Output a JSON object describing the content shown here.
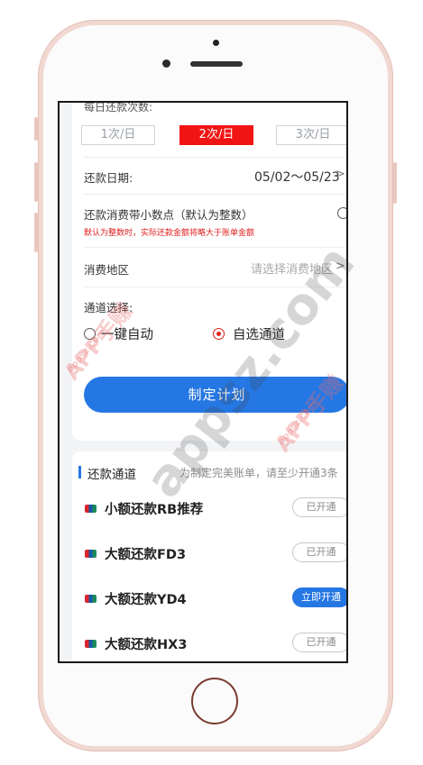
{
  "daily": {
    "label": "每日还款次数:",
    "options": [
      "1次/日",
      "2次/日",
      "3次/日"
    ],
    "selected_index": 1
  },
  "repay_date": {
    "label": "还款日期:",
    "value": "05/02～05/23"
  },
  "decimal": {
    "label": "还款消费带小数点（默认为整数）",
    "warning": "默认为整数时，实际还款金额将略大于账单金额"
  },
  "region": {
    "label": "消费地区",
    "placeholder": "请选择消费地区"
  },
  "channel_select": {
    "label": "通道选择:",
    "options": [
      "一键自动",
      "自选通道"
    ],
    "selected_index": 1
  },
  "plan_button": "制定计划",
  "channels": {
    "title": "还款通道",
    "hint": "为制定完美账单，请至少开通3条",
    "items": [
      {
        "name": "小额还款RB推荐",
        "action": "已开通",
        "style": "outline"
      },
      {
        "name": "大额还款FD3",
        "action": "已开通",
        "style": "outline"
      },
      {
        "name": "大额还款YD4",
        "action": "立即开通",
        "style": "primary"
      },
      {
        "name": "大额还款HX3",
        "action": "已开通",
        "style": "outline"
      }
    ]
  },
  "watermark": {
    "line1": "APP手赚",
    "line2": "appsz.com",
    "big": "appsz.com"
  },
  "colors": {
    "accent_blue": "#2577e3",
    "active_red": "#f01414",
    "warning_red": "#e02020"
  }
}
